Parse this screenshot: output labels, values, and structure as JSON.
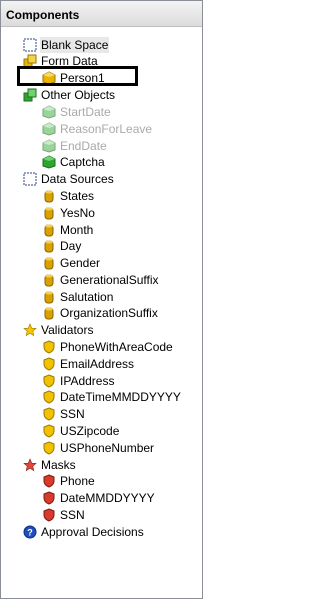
{
  "panel": {
    "title": "Components"
  },
  "tree": {
    "blank_space": "Blank Space",
    "form_data": "Form Data",
    "person1": "Person1",
    "other_objects": "Other Objects",
    "start_date": "StartDate",
    "reason_for_leave": "ReasonForLeave",
    "end_date": "EndDate",
    "captcha": "Captcha",
    "data_sources": "Data Sources",
    "data_source_items": [
      "States",
      "YesNo",
      "Month",
      "Day",
      "Gender",
      "GenerationalSuffix",
      "Salutation",
      "OrganizationSuffix"
    ],
    "validators": "Validators",
    "validator_items": [
      "PhoneWithAreaCode",
      "EmailAddress",
      "IPAddress",
      "DateTimeMMDDYYYY",
      "SSN",
      "USZipcode",
      "USPhoneNumber"
    ],
    "masks": "Masks",
    "mask_items": [
      "Phone",
      "DateMMDDYYYY",
      "SSN"
    ],
    "approval_decisions": "Approval Decisions"
  },
  "colors": {
    "cube_gold": "#e7b400",
    "cube_green": "#2ea52e",
    "cylinder_gold": "#d8a100",
    "shield_gold": "#f2c200",
    "shield_red": "#d93a2b",
    "star_yellow": "#f5c400",
    "star_red": "#e0473a",
    "help_blue": "#1f4fbf"
  }
}
